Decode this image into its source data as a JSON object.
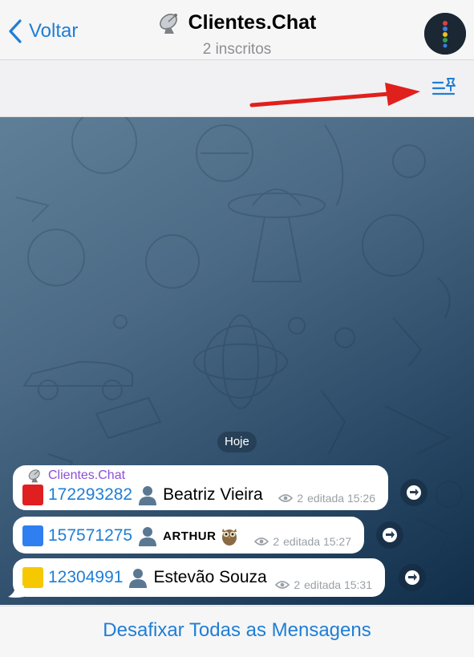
{
  "nav": {
    "back_label": "Voltar",
    "title": "Clientes.Chat",
    "subtitle": "2 inscritos"
  },
  "date_separator": "Hoje",
  "messages": [
    {
      "sender": "Clientes.Chat",
      "square_color": "#e02020",
      "number": "172293282",
      "name": "Beatriz Vieira",
      "views": "2",
      "status": "editada 15:26"
    },
    {
      "square_color": "#2f7ff0",
      "number": "157571275",
      "name": "ARTHUR",
      "views": "2",
      "status": "editada 15:27"
    },
    {
      "square_color": "#f5c800",
      "number": "12304991",
      "name": "Estevão Souza",
      "views": "2",
      "status": "editada 15:31"
    }
  ],
  "bottom": {
    "unpin_label": "Desafixar Todas as Mensagens"
  },
  "icons": {
    "back": "chevron-left-icon",
    "satellite": "satellite-icon",
    "pinned_list": "pinned-list-icon",
    "person": "person-icon",
    "owl": "owl-icon",
    "eye": "eye-icon",
    "share": "share-icon"
  },
  "colors": {
    "accent": "#1f7ed6",
    "sender": "#8c4fd6",
    "annotation_arrow": "#e0201c"
  }
}
